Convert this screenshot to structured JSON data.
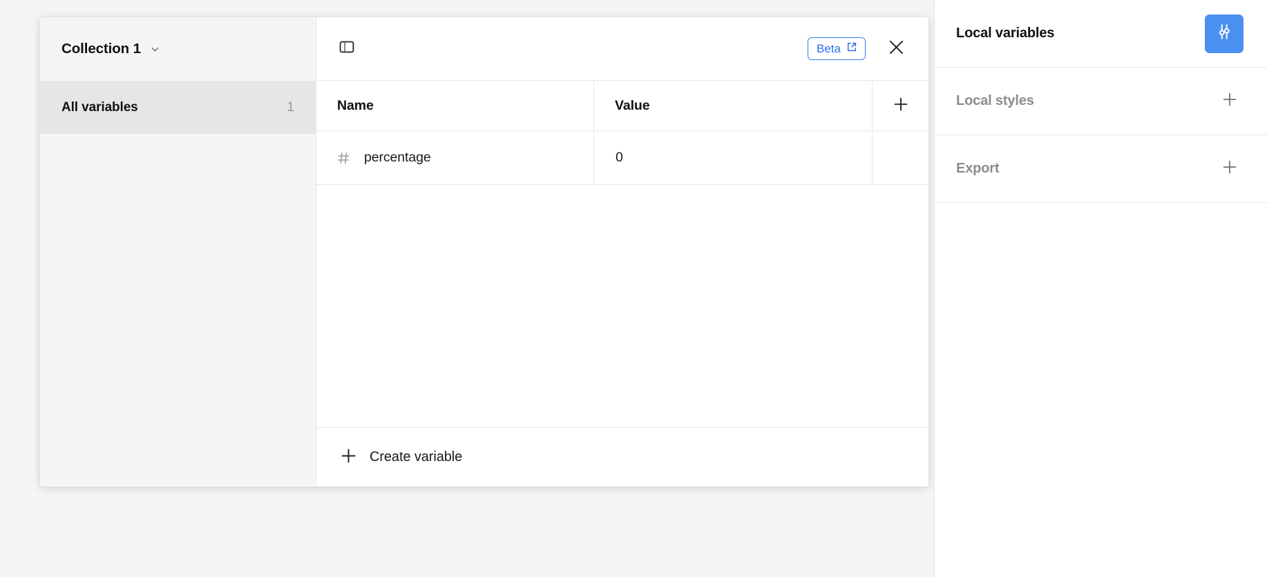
{
  "modal": {
    "sidebar": {
      "collection_title": "Collection 1",
      "collection_chevron_icon": "chevron-down-icon",
      "nav_items": [
        {
          "label": "All variables",
          "count": "1",
          "selected": true
        }
      ]
    },
    "topbar": {
      "panel_toggle_icon": "sidebar-toggle-icon",
      "beta_label": "Beta",
      "beta_external_icon": "external-link-icon",
      "close_icon": "close-icon"
    },
    "table": {
      "columns": [
        {
          "label": "Name"
        },
        {
          "label": "Value"
        }
      ],
      "add_column_icon": "plus-icon",
      "rows": [
        {
          "type_icon": "number-variable-icon",
          "type_glyph": "#",
          "name": "percentage",
          "value": "0"
        }
      ]
    },
    "footer": {
      "create_label": "Create variable",
      "create_icon": "plus-icon"
    }
  },
  "right_panel": {
    "sections": [
      {
        "title": "Local variables",
        "muted": false,
        "control": "variables-toggle-button",
        "control_icon": "sliders-icon",
        "control_active": true
      },
      {
        "title": "Local styles",
        "muted": true,
        "control": "plus-button",
        "control_icon": "plus-icon",
        "control_active": false
      },
      {
        "title": "Export",
        "muted": true,
        "control": "plus-button",
        "control_icon": "plus-icon",
        "control_active": false
      }
    ]
  },
  "colors": {
    "accent_blue": "#4a90f0",
    "beta_blue": "#2a6dee",
    "canvas_bg": "#f5f5f5",
    "selected_row_bg": "#e6e6e6",
    "border": "#e6e6e6",
    "muted_text": "#8c8c8c"
  }
}
